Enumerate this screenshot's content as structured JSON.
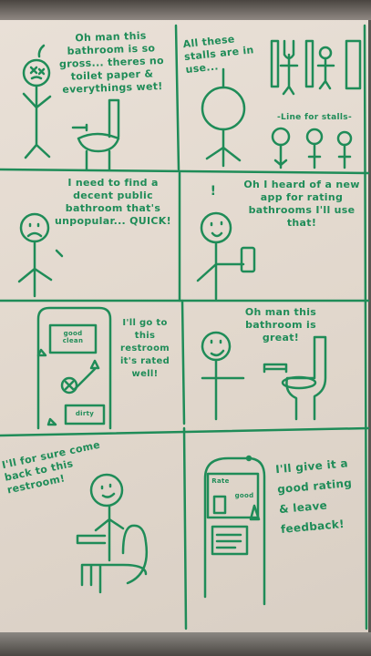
{
  "colors": {
    "marker": "#1f8c58",
    "board": "#e4dace",
    "frame": "#5b5651"
  },
  "panels": [
    {
      "id": 1,
      "text": "Oh man this bathroom is so gross... theres no toilet paper & everythings wet!"
    },
    {
      "id": 2,
      "text": "All these stalls are in use...",
      "label": "-Line for stalls-"
    },
    {
      "id": 3,
      "text": "I need to find a decent public bathroom that's unpopular... QUICK!"
    },
    {
      "id": 4,
      "exclaim": "!",
      "text": "Oh I heard of a new app for rating bathrooms I'll use that!"
    },
    {
      "id": 5,
      "text": "I'll go to this restroom it's rated well!",
      "phone": {
        "good": "good clean",
        "bad": "dirty"
      }
    },
    {
      "id": 6,
      "text": "Oh man this bathroom is great!"
    },
    {
      "id": 7,
      "text": "I'll for sure come back to this restroom!"
    },
    {
      "id": 8,
      "text": "I'll give it a good rating & leave feedback!",
      "phone": {
        "rate": "Rate",
        "good": "good"
      }
    }
  ]
}
